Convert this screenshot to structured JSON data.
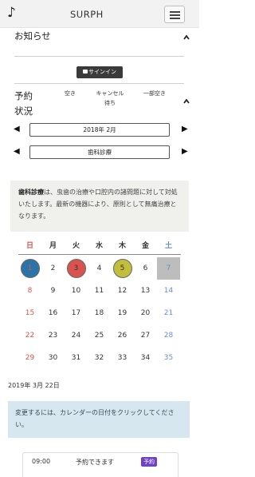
{
  "navbar": {
    "icon": "music-note-icon",
    "title": "SURPH"
  },
  "notice": {
    "title": "お知らせ",
    "signin_label": "サインイン"
  },
  "status": {
    "title_line1": "予約",
    "title_line2": "状況",
    "legend": [
      "空き",
      "キャンセル待ち",
      "一部空き"
    ],
    "month_label": "2018年 2月",
    "category_label": "歯科診療"
  },
  "info": {
    "heading": "歯科診療",
    "body": "は、虫歯の治療や口腔内の諸問題に対して対処いたします。最新の機器により、原則として無痛治療となります。"
  },
  "calendar": {
    "weekdays": [
      "日",
      "月",
      "火",
      "水",
      "木",
      "金",
      "土"
    ],
    "weekday_colors": [
      "#d9534f",
      "#333333",
      "#333333",
      "#333333",
      "#333333",
      "#333333",
      "#6a8fd0"
    ],
    "weeks": [
      [
        "1",
        "2",
        "3",
        "4",
        "5",
        "6",
        "7"
      ],
      [
        "8",
        "9",
        "10",
        "11",
        "12",
        "13",
        "14"
      ],
      [
        "15",
        "16",
        "17",
        "18",
        "19",
        "20",
        "21"
      ],
      [
        "22",
        "23",
        "24",
        "25",
        "26",
        "27",
        "28"
      ],
      [
        "29",
        "30",
        "31",
        "32",
        "33",
        "34",
        "35"
      ]
    ],
    "status_colors": {
      "available": "#2a74a8",
      "waitlist": "#d9534f",
      "partial": "#c2bd3a",
      "selected": "#bdbdbd"
    }
  },
  "selected_date": "2019年 3月 22日",
  "note": "変更するには、カレンダーの日付をクリックしてください。",
  "slot": {
    "time": "09:00",
    "status": "予約できます",
    "badge": "予約",
    "badge_color": "#6f42c1"
  }
}
